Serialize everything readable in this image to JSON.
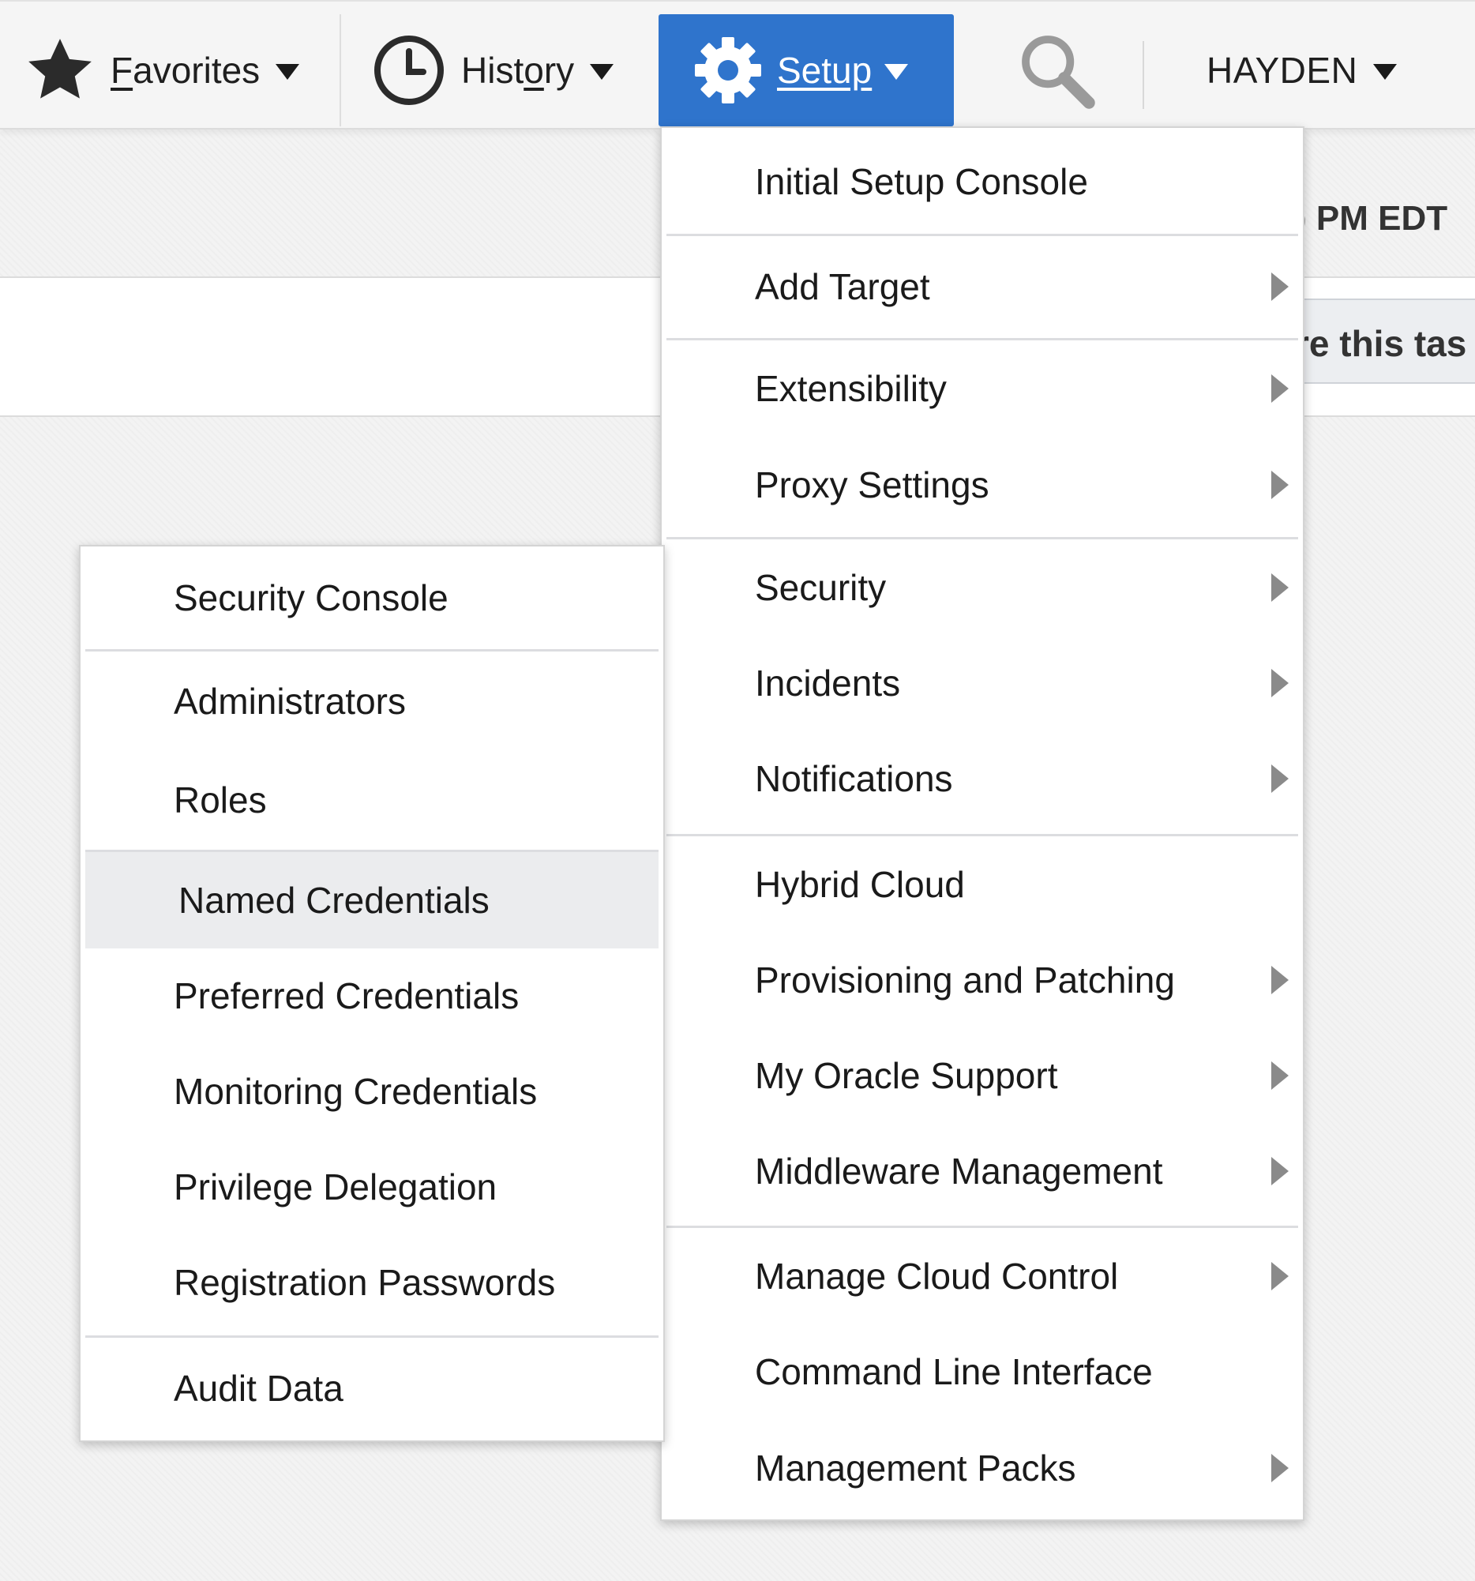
{
  "nav": {
    "favorites": {
      "first": "F",
      "rest": "avorites"
    },
    "history": {
      "pre": "Hist",
      "ul": "o",
      "post": "ry"
    },
    "setup": "Setup",
    "user": "HAYDEN"
  },
  "background": {
    "time_fragment": ") PM EDT",
    "task_fragment": "re this tas"
  },
  "setup_menu": [
    {
      "label": "Initial Setup Console"
    },
    {
      "label": "Add Target"
    },
    {
      "label": "Extensibility"
    },
    {
      "label": "Proxy Settings"
    },
    {
      "label": "Security"
    },
    {
      "label": "Incidents"
    },
    {
      "label": "Notifications"
    },
    {
      "label": "Hybrid Cloud"
    },
    {
      "label": "Provisioning and Patching"
    },
    {
      "label": "My Oracle Support"
    },
    {
      "label": "Middleware Management"
    },
    {
      "label": "Manage Cloud Control"
    },
    {
      "label": "Command Line Interface"
    },
    {
      "label": "Management Packs"
    }
  ],
  "security_menu": [
    {
      "label": "Security Console"
    },
    {
      "label": "Administrators"
    },
    {
      "label": "Roles"
    },
    {
      "label": "Named Credentials"
    },
    {
      "label": "Preferred Credentials"
    },
    {
      "label": "Monitoring Credentials"
    },
    {
      "label": "Privilege Delegation"
    },
    {
      "label": "Registration Passwords"
    },
    {
      "label": "Audit Data"
    }
  ]
}
